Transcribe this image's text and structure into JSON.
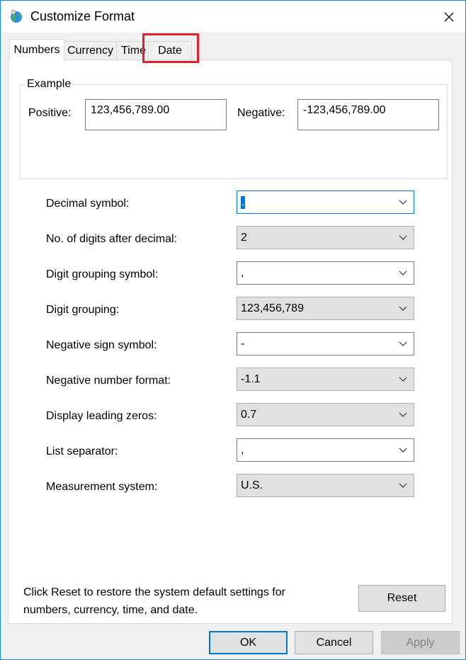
{
  "window": {
    "title": "Customize Format"
  },
  "tabs": [
    {
      "label": "Numbers",
      "active": true
    },
    {
      "label": "Currency",
      "active": false
    },
    {
      "label": "Time",
      "active": false
    },
    {
      "label": "Date",
      "active": false
    }
  ],
  "example": {
    "group_label": "Example",
    "positive_label": "Positive:",
    "positive_value": "123,456,789.00",
    "negative_label": "Negative:",
    "negative_value": "-123,456,789.00"
  },
  "settings": [
    {
      "label": "Decimal symbol:",
      "value": ".",
      "kind": "editable",
      "focused": true
    },
    {
      "label": "No. of digits after decimal:",
      "value": "2",
      "kind": "readonly"
    },
    {
      "label": "Digit grouping symbol:",
      "value": ",",
      "kind": "editable"
    },
    {
      "label": "Digit grouping:",
      "value": "123,456,789",
      "kind": "readonly"
    },
    {
      "label": "Negative sign symbol:",
      "value": "-",
      "kind": "editable"
    },
    {
      "label": "Negative number format:",
      "value": "-1.1",
      "kind": "readonly"
    },
    {
      "label": "Display leading zeros:",
      "value": "0.7",
      "kind": "readonly"
    },
    {
      "label": "List separator:",
      "value": ",",
      "kind": "editable"
    },
    {
      "label": "Measurement system:",
      "value": "U.S.",
      "kind": "readonly"
    }
  ],
  "footer": {
    "note": "Click Reset to restore the system default settings for numbers, currency, time, and date.",
    "reset_label": "Reset",
    "ok_label": "OK",
    "cancel_label": "Cancel",
    "apply_label": "Apply"
  },
  "colors": {
    "accent": "#0078d7",
    "highlight_box": "#e0202a",
    "panel_bg": "#ffffff",
    "dialog_bg": "#f0f0f0"
  }
}
